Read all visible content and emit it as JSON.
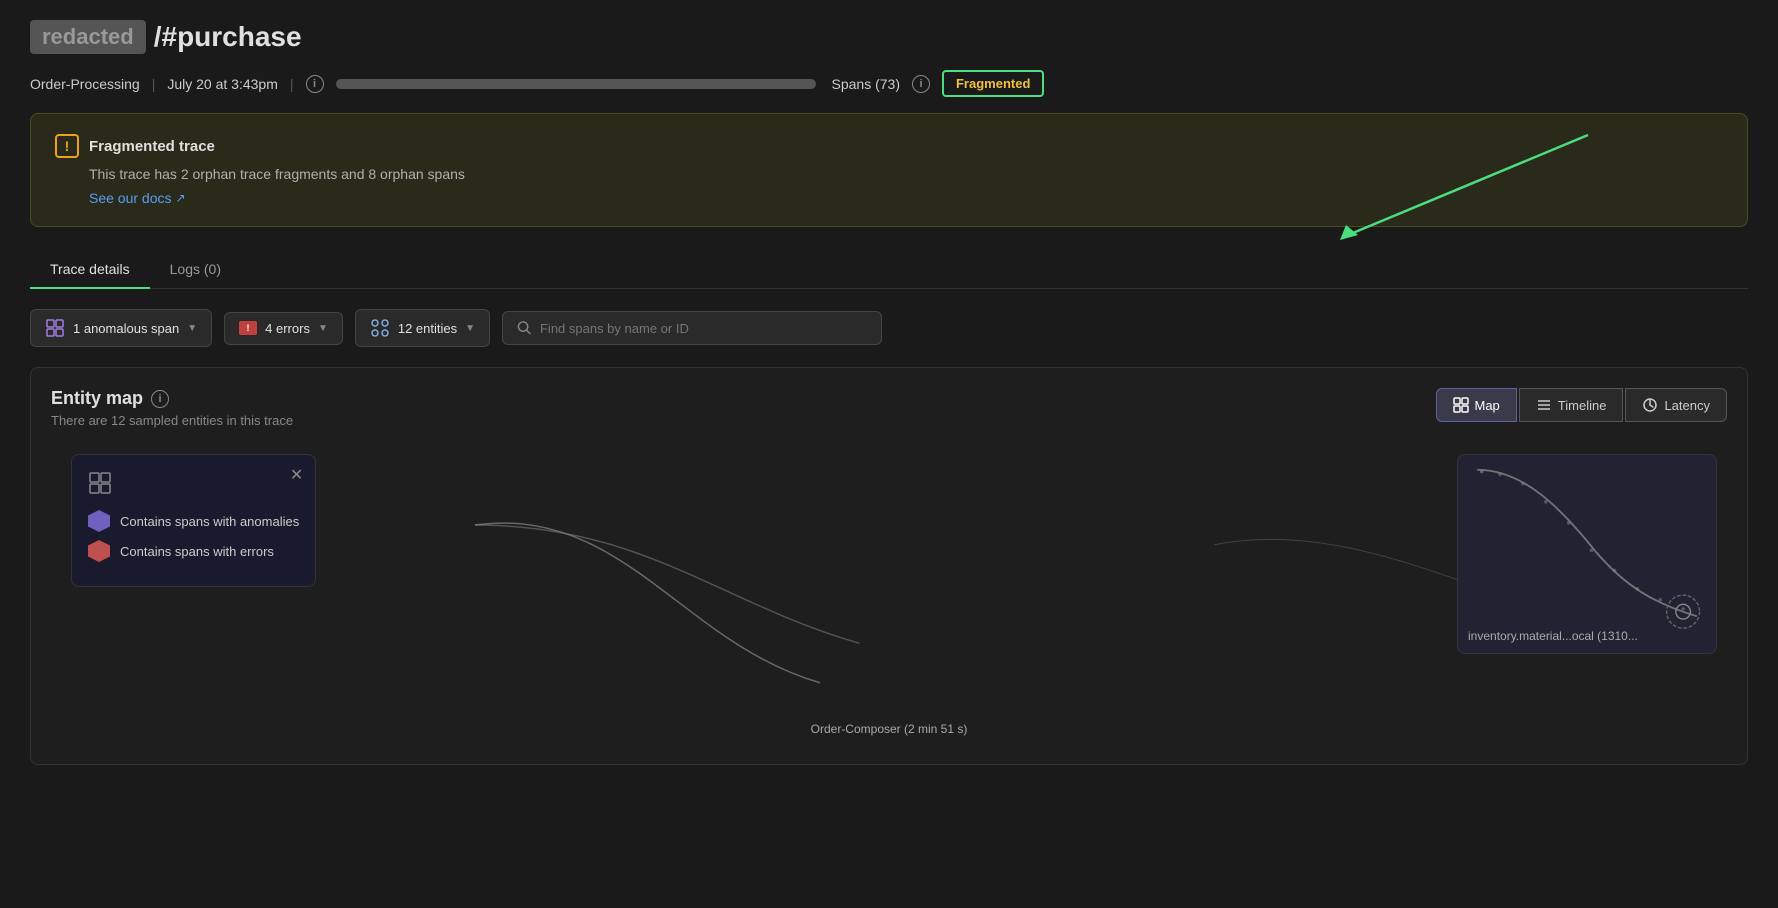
{
  "header": {
    "title_prefix": "redacted",
    "title_hash": "/#purchase",
    "service": "Order-Processing",
    "date": "July 20 at 3:43pm",
    "spans_label": "Spans (73)",
    "fragmented_label": "Fragmented"
  },
  "banner": {
    "title": "Fragmented trace",
    "description": "This trace has 2 orphan trace fragments and 8 orphan spans",
    "link_text": "See our docs",
    "warning_symbol": "!"
  },
  "tabs": [
    {
      "label": "Trace details",
      "active": true
    },
    {
      "label": "Logs (0)",
      "active": false
    }
  ],
  "filters": {
    "anomalous_label": "1 anomalous span",
    "errors_label": "4 errors",
    "entities_label": "12 entities",
    "search_placeholder": "Find spans by name or ID"
  },
  "entity_map": {
    "title": "Entity map",
    "subtitle": "There are 12 sampled entities in this trace",
    "views": [
      {
        "label": "Map",
        "active": true
      },
      {
        "label": "Timeline",
        "active": false
      },
      {
        "label": "Latency",
        "active": false
      }
    ],
    "legend": {
      "anomaly_label": "Contains spans with anomalies",
      "error_label": "Contains spans with errors"
    },
    "order_composer_label": "Order-Composer (2 min 51 s)",
    "inventory_label": "inventory.material...ocal (1310..."
  }
}
